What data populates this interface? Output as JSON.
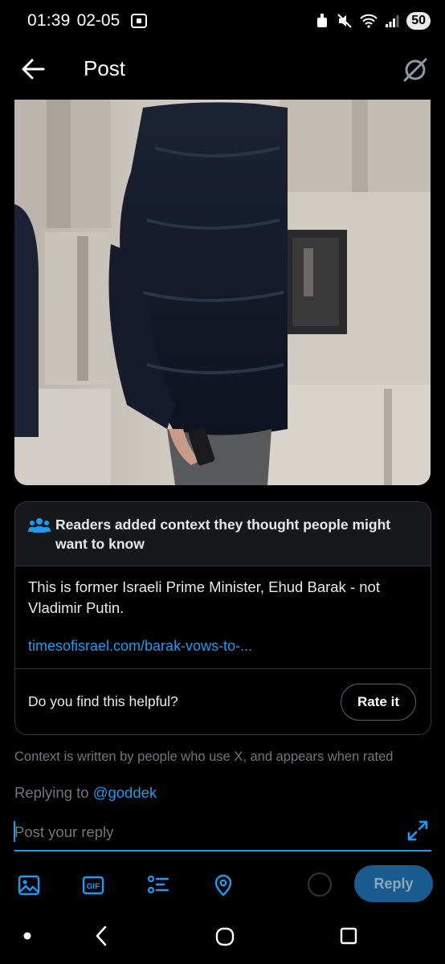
{
  "status_bar": {
    "time": "01:39",
    "date": "02-05",
    "battery": "50"
  },
  "header": {
    "title": "Post"
  },
  "photo": {
    "description_icon": "photo-of-man-in-puffer-jacket"
  },
  "context_note": {
    "title": "Readers added context they thought people might want to know",
    "body": "This is former Israeli Prime Minister, Ehud Barak - not Vladimir Putin.",
    "link": "timesofisrael.com/barak-vows-to-...",
    "helpful_question": "Do you find this helpful?",
    "rate_label": "Rate it",
    "disclaimer": "Context is written by people who use X, and appears when rated"
  },
  "reply": {
    "replying_to_prefix": "Replying to ",
    "handle": "@goddek",
    "placeholder": "Post your reply",
    "reply_label": "Reply"
  },
  "colors": {
    "accent": "#1d9bf0",
    "background": "#000000",
    "muted": "#71767b",
    "card": "#16181c"
  }
}
